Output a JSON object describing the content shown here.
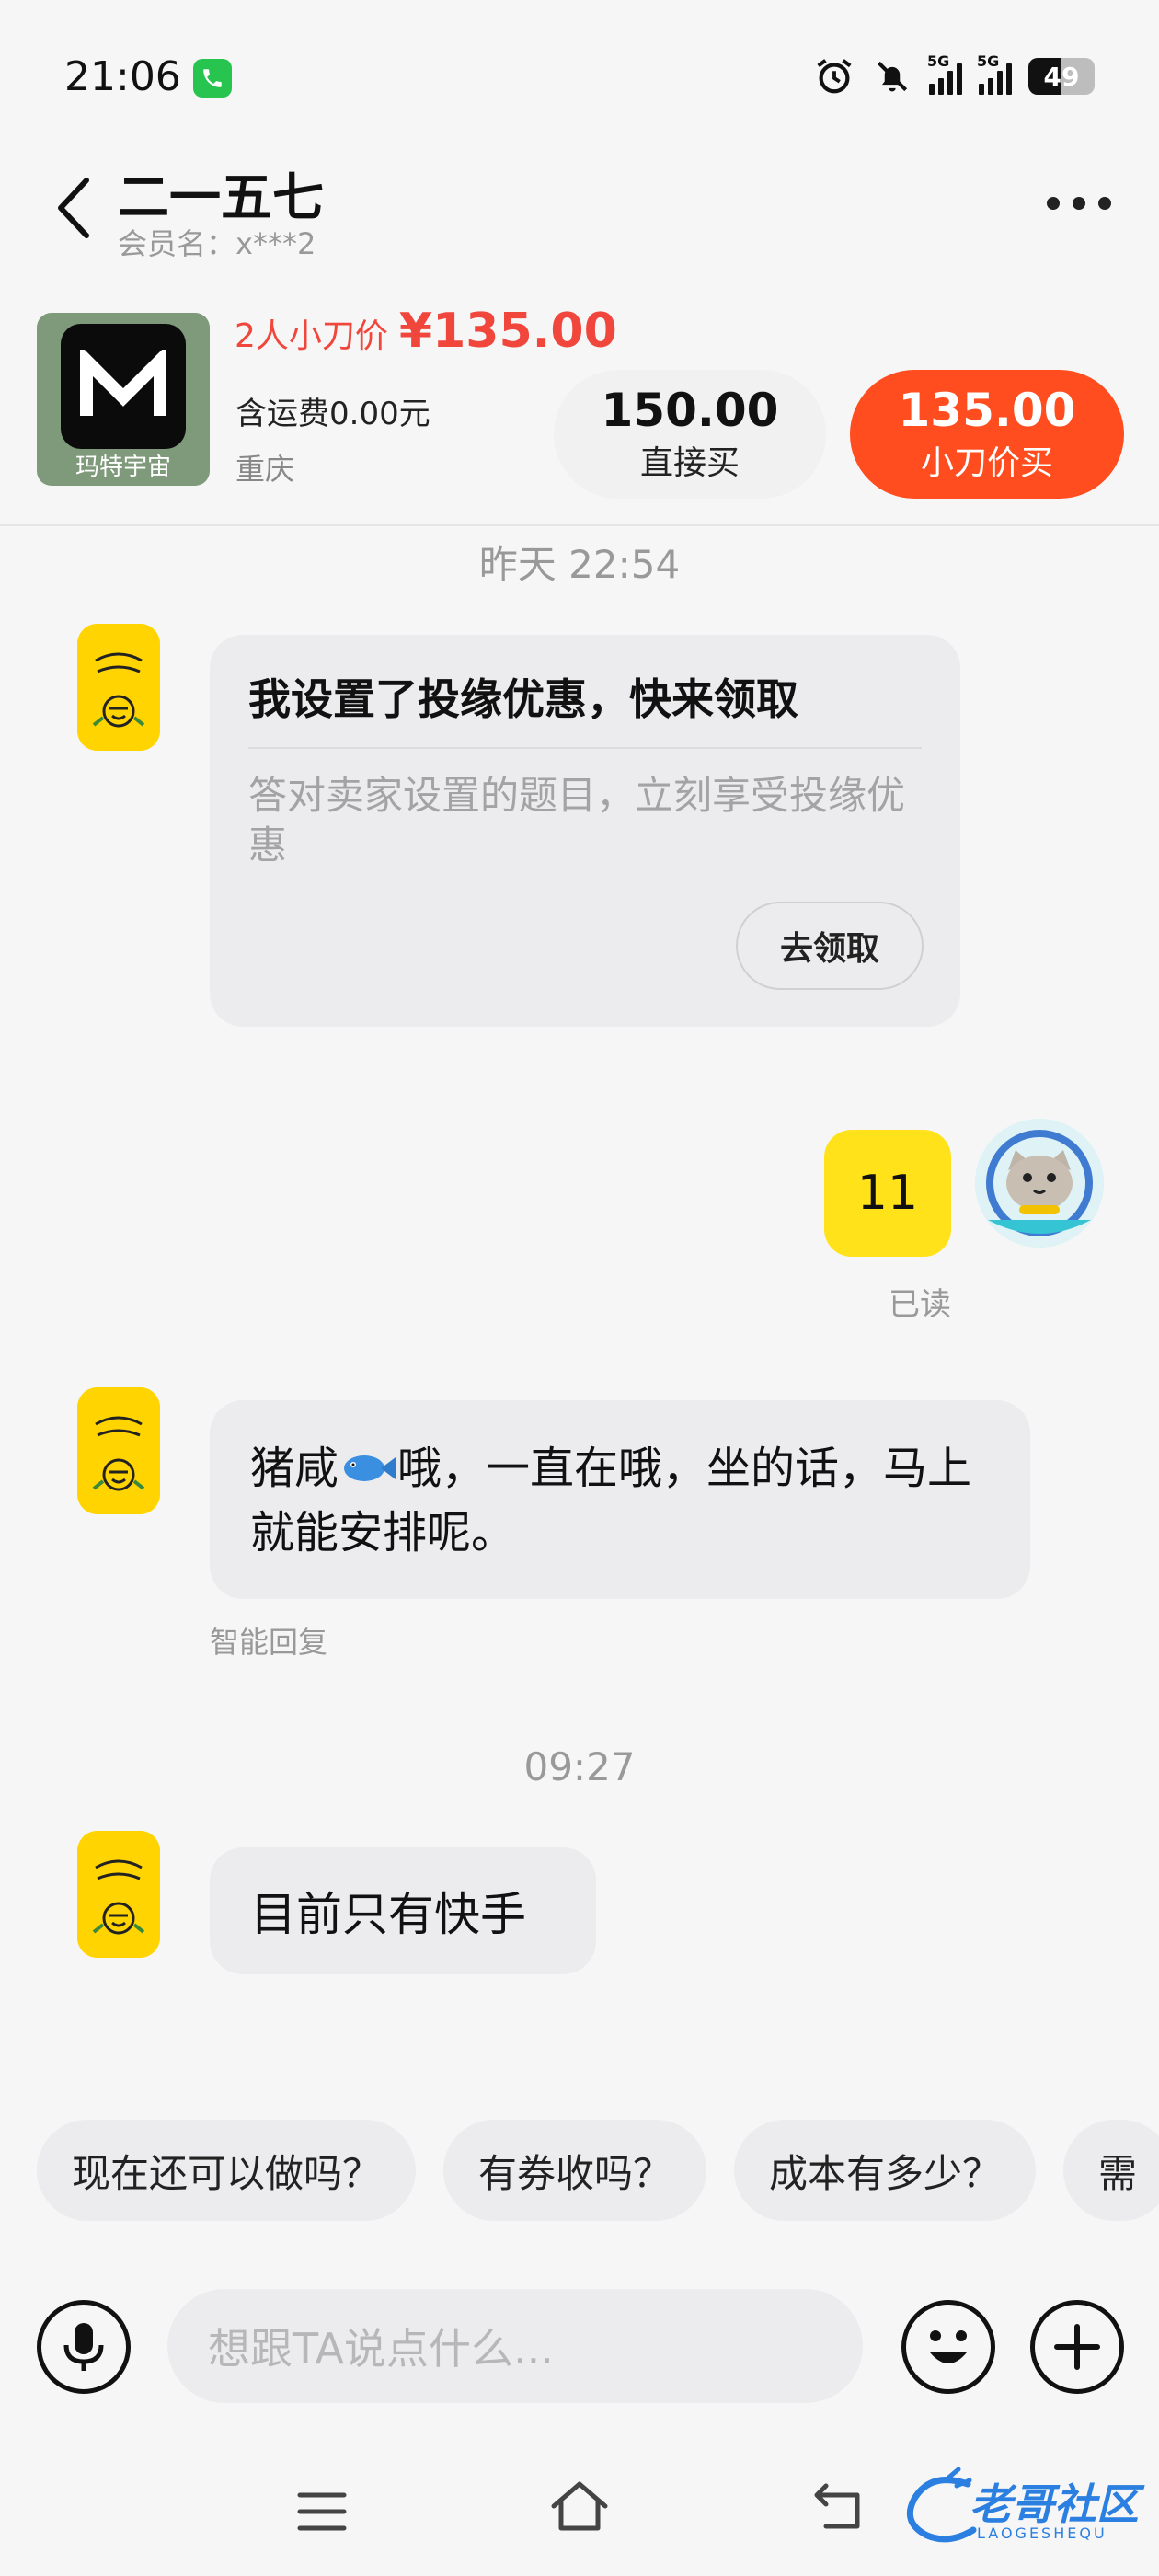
{
  "status_bar": {
    "time": "21:06",
    "network_1": "5G",
    "network_2": "5G",
    "battery": "49"
  },
  "header": {
    "title": "二一五七",
    "subtitle": "会员名：x***2"
  },
  "product": {
    "image_brand": "玛特宇宙",
    "price_label": "2人小刀价",
    "price_value": "¥135.00",
    "shipping": "含运费0.00元",
    "location": "重庆",
    "direct_price": "150.00",
    "direct_label": "直接买",
    "kanjia_price": "135.00",
    "kanjia_label": "小刀价买"
  },
  "chat": {
    "timestamp_1": "昨天 22:54",
    "coupon": {
      "title": "我设置了投缘优惠，快来领取",
      "description": "答对卖家设置的题目，立刻享受投缘优惠",
      "button": "去领取"
    },
    "my_message": "11",
    "read_status": "已读",
    "seller_message_2_part1": "猪咸",
    "seller_message_2_part2": "哦，一直在哦，坐的话，马上就能安排呢。",
    "smart_reply_tag": "智能回复",
    "timestamp_2": "09:27",
    "seller_message_3": "目前只有快手"
  },
  "quick_replies": [
    "现在还可以做吗？",
    "有券收吗？",
    "成本有多少？",
    "需"
  ],
  "input": {
    "placeholder": "想跟TA说点什么..."
  },
  "watermark": {
    "text": "老哥社区",
    "sub": "LAOGESHEQU"
  },
  "colors": {
    "accent_red": "#ff4d1f",
    "price_red": "#f0463b",
    "my_bubble": "#ffe21a",
    "seller_avatar": "#ffd400"
  }
}
